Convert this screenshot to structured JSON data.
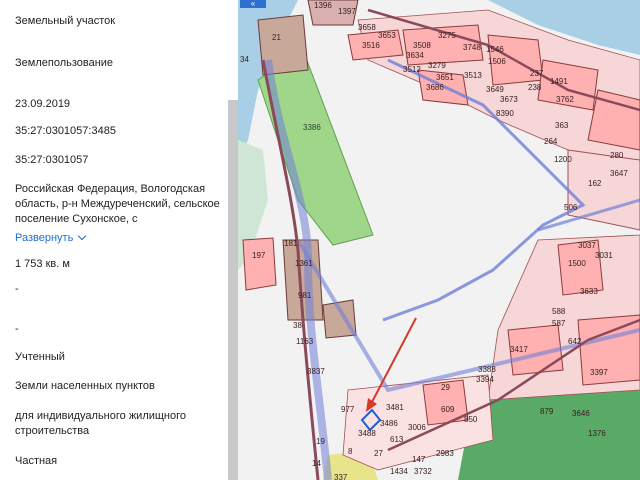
{
  "panel": {
    "fields": [
      "Земельный участок",
      "Землепользование",
      "23.09.2019",
      "35:27:0301057:3485",
      "35:27:0301057",
      "Российская Федерация, Вологодская область, р-н Междуреченский, сельское поселение Сухонское, с",
      "1 753 кв. м",
      "-",
      "-",
      "Учтенный",
      "Земли населенных пунктов",
      "для индивидуального жилищного строительства",
      "Частная"
    ],
    "expand_label": "Развернуть"
  },
  "map": {
    "back_label": "«",
    "parcel_labels": [
      {
        "id": "l1396",
        "text": "1396"
      },
      {
        "id": "l1397",
        "text": "1397"
      },
      {
        "id": "l3658",
        "text": "3658"
      },
      {
        "id": "l3653",
        "text": "3653"
      },
      {
        "id": "l3516",
        "text": "3516"
      },
      {
        "id": "l3508",
        "text": "3508"
      },
      {
        "id": "l3275",
        "text": "3275"
      },
      {
        "id": "l3748",
        "text": "3748"
      },
      {
        "id": "l1546",
        "text": "1546"
      },
      {
        "id": "l3634",
        "text": "3634"
      },
      {
        "id": "l1506",
        "text": "1506"
      },
      {
        "id": "l3512",
        "text": "3512"
      },
      {
        "id": "l3279",
        "text": "3279"
      },
      {
        "id": "l3651",
        "text": "3651"
      },
      {
        "id": "l3513",
        "text": "3513"
      },
      {
        "id": "l3686",
        "text": "3686"
      },
      {
        "id": "l3649",
        "text": "3649"
      },
      {
        "id": "l3673",
        "text": "3673"
      },
      {
        "id": "l237",
        "text": "237"
      },
      {
        "id": "l1491",
        "text": "1491"
      },
      {
        "id": "l238",
        "text": "238"
      },
      {
        "id": "l3762",
        "text": "3762"
      },
      {
        "id": "l8390",
        "text": "8390"
      },
      {
        "id": "l363",
        "text": "363"
      },
      {
        "id": "l264",
        "text": "264"
      },
      {
        "id": "l1200",
        "text": "1200"
      },
      {
        "id": "l280",
        "text": "280"
      },
      {
        "id": "l3647",
        "text": "3647"
      },
      {
        "id": "l162",
        "text": "162"
      },
      {
        "id": "l506",
        "text": "506"
      },
      {
        "id": "l21",
        "text": "21"
      },
      {
        "id": "l34",
        "text": "34"
      },
      {
        "id": "l3386",
        "text": "3386"
      },
      {
        "id": "l181",
        "text": "181"
      },
      {
        "id": "l197",
        "text": "197"
      },
      {
        "id": "l1361",
        "text": "1361"
      },
      {
        "id": "l981",
        "text": "981"
      },
      {
        "id": "l38",
        "text": "38"
      },
      {
        "id": "l1163",
        "text": "1163"
      },
      {
        "id": "l3837",
        "text": "3837"
      },
      {
        "id": "l3037",
        "text": "3037"
      },
      {
        "id": "l1500",
        "text": "1500"
      },
      {
        "id": "l3031",
        "text": "3031"
      },
      {
        "id": "l3633",
        "text": "3633"
      },
      {
        "id": "l3417",
        "text": "3417"
      },
      {
        "id": "l642",
        "text": "642"
      },
      {
        "id": "l3388",
        "text": "3388"
      },
      {
        "id": "l3394",
        "text": "3394"
      },
      {
        "id": "l977",
        "text": "977"
      },
      {
        "id": "l3481",
        "text": "3481"
      },
      {
        "id": "l3486",
        "text": "3486"
      },
      {
        "id": "l3488",
        "text": "3488"
      },
      {
        "id": "l613",
        "text": "613"
      },
      {
        "id": "l3006",
        "text": "3006"
      },
      {
        "id": "l609",
        "text": "609"
      },
      {
        "id": "l29",
        "text": "29"
      },
      {
        "id": "l147",
        "text": "147"
      },
      {
        "id": "l2983",
        "text": "2983"
      },
      {
        "id": "l1434",
        "text": "1434"
      },
      {
        "id": "l3732",
        "text": "3732"
      },
      {
        "id": "l14",
        "text": "14"
      },
      {
        "id": "l19",
        "text": "19"
      },
      {
        "id": "l337",
        "text": "337"
      },
      {
        "id": "l1376",
        "text": "1376"
      },
      {
        "id": "l3397",
        "text": "3397"
      },
      {
        "id": "l3646",
        "text": "3646"
      },
      {
        "id": "l879",
        "text": "879"
      },
      {
        "id": "l850",
        "text": "850"
      },
      {
        "id": "l588",
        "text": "588"
      },
      {
        "id": "l587",
        "text": "587"
      },
      {
        "id": "l27",
        "text": "27"
      },
      {
        "id": "l8",
        "text": "8"
      }
    ],
    "colors": {
      "water": "#a9cfe6",
      "highlight_parcel": "#ffb0b0",
      "parcel_border": "#8a3a3a",
      "green_zone": "#9fd68a",
      "zone_line": "#6f80d8",
      "arrow": "#d43a2a",
      "selected": "#1e5fd6"
    }
  }
}
